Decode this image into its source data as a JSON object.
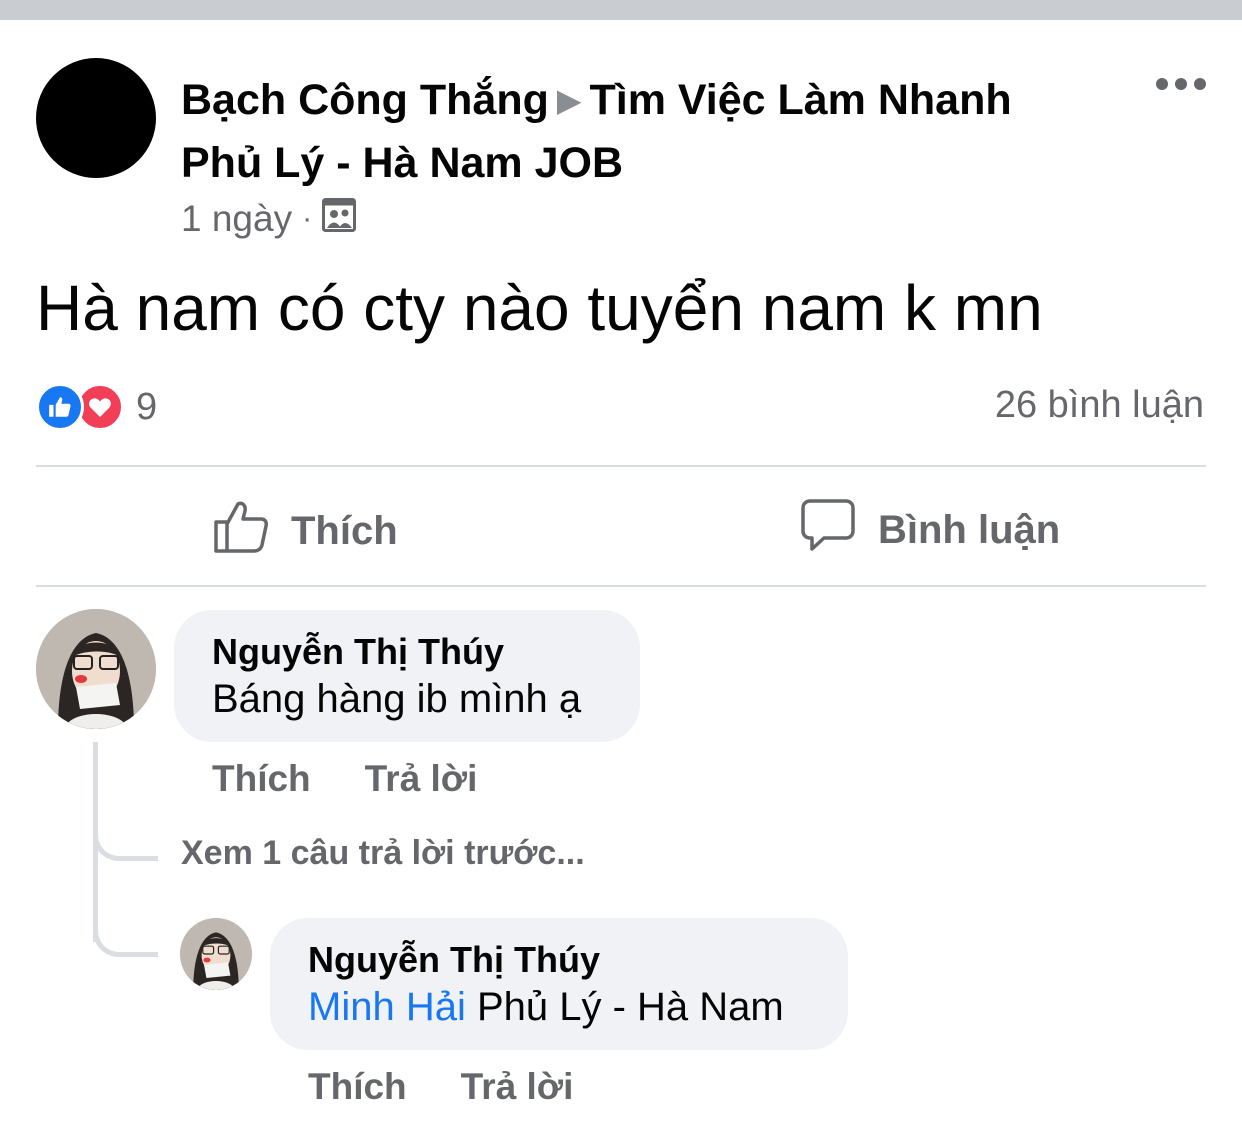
{
  "post": {
    "author": "Bạch Công Thắng",
    "arrow": "▶",
    "group": "Tìm Việc Làm Nhanh Phủ Lý - Hà Nam JOB",
    "time": "1 ngày",
    "separator": "·",
    "audience_icon": "group-audience-icon",
    "text": "Hà nam có cty nào tuyển nam k mn",
    "reaction_count": "9",
    "comments_count": "26 bình luận",
    "reaction_icons": [
      "like-reaction-icon",
      "love-reaction-icon"
    ]
  },
  "actions": {
    "like_label": "Thích",
    "comment_label": "Bình luận"
  },
  "comments": [
    {
      "name": "Nguyễn Thị Thúy",
      "text": "Báng hàng ib mình ạ",
      "like_label": "Thích",
      "reply_label": "Trả lời"
    }
  ],
  "see_previous_replies": "Xem 1 câu trả lời trước...",
  "replies": [
    {
      "name": "Nguyễn Thị Thúy",
      "mention": "Minh Hải",
      "text": " Phủ Lý - Hà Nam",
      "like_label": "Thích",
      "reply_label": "Trả lời"
    }
  ],
  "colors": {
    "accent": "#1877f2",
    "like_blue": "#1877f2",
    "love_red": "#f33e58",
    "secondary_text": "#65676b",
    "bubble": "#f0f2f5"
  }
}
